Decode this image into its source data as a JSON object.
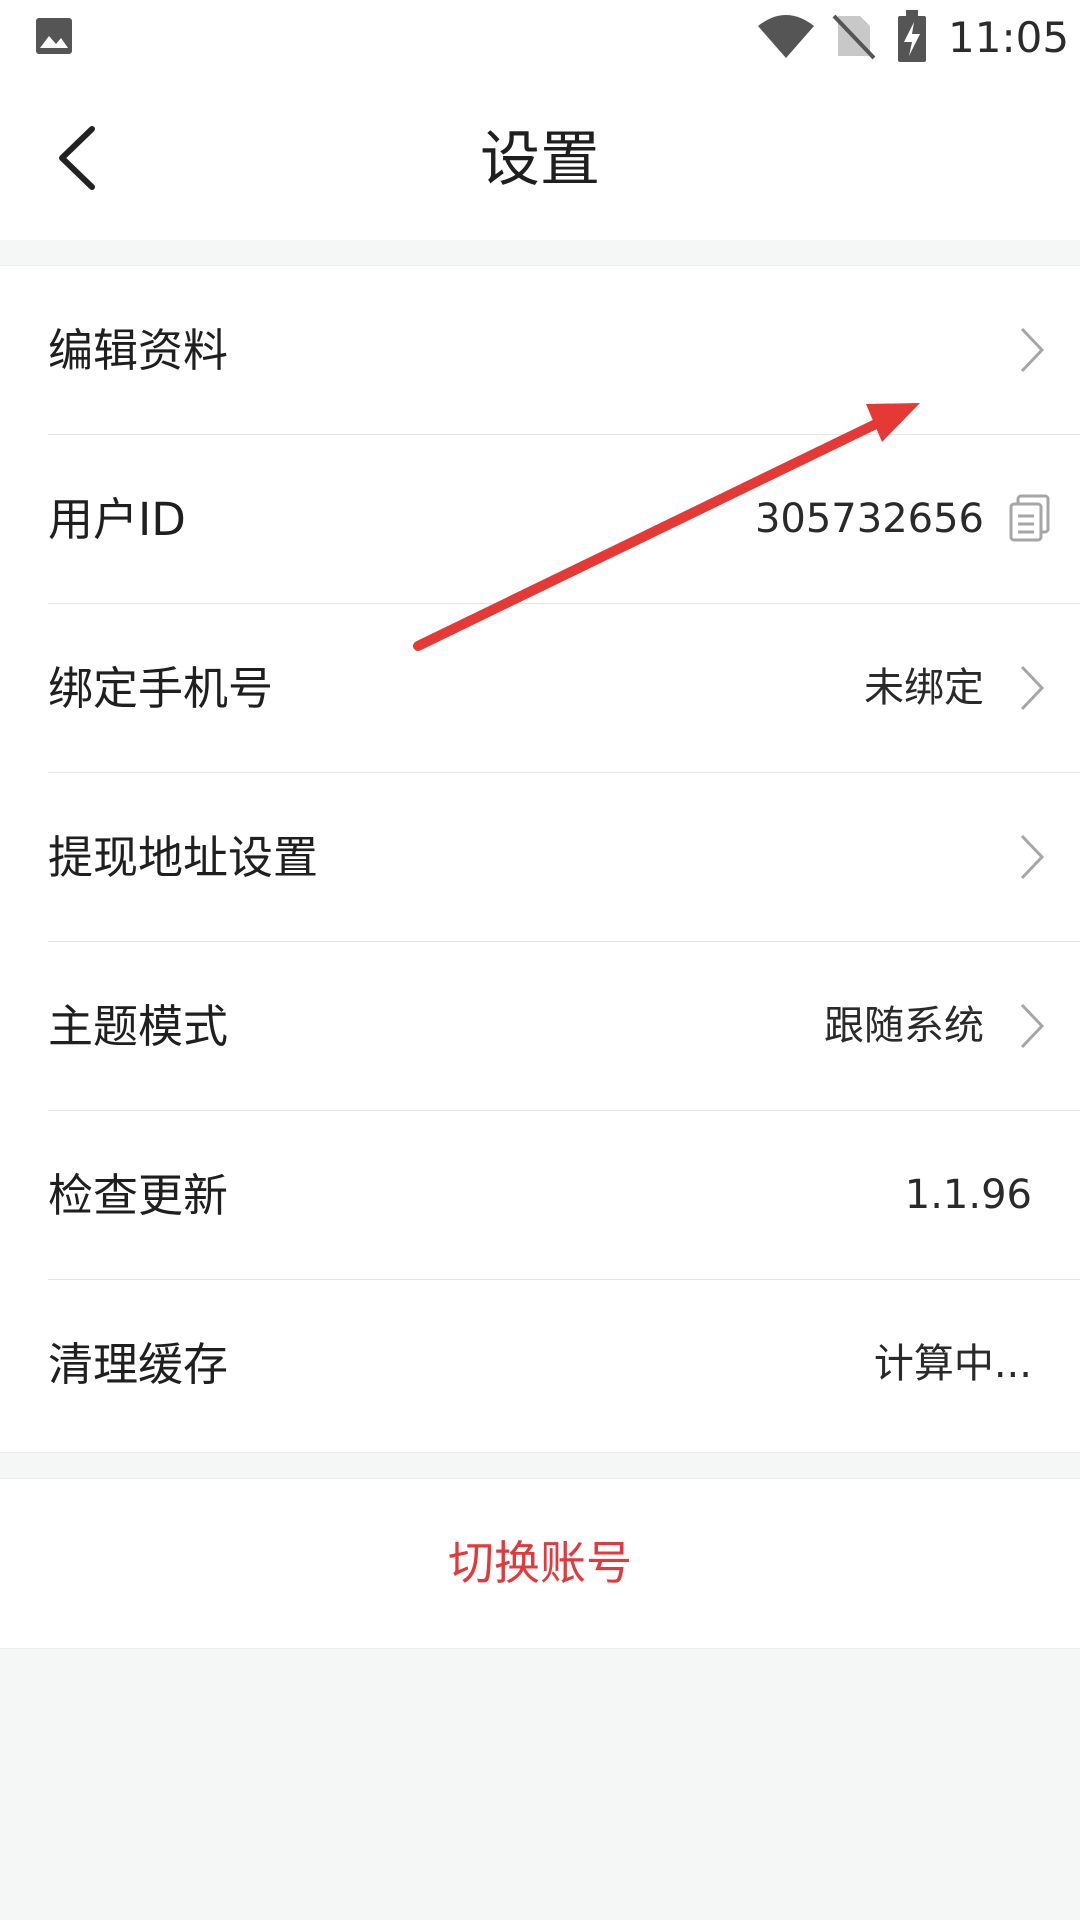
{
  "status_bar": {
    "time": "11:05",
    "icons": [
      "gallery-icon",
      "wifi-icon",
      "no-sim-icon",
      "battery-charging-icon"
    ]
  },
  "header": {
    "title": "设置",
    "back_icon": "chevron-left-icon"
  },
  "settings": {
    "edit_profile": {
      "label": "编辑资料"
    },
    "user_id": {
      "label": "用户ID",
      "value": "305732656"
    },
    "bind_phone": {
      "label": "绑定手机号",
      "value": "未绑定"
    },
    "withdraw_address": {
      "label": "提现地址设置"
    },
    "theme_mode": {
      "label": "主题模式",
      "value": "跟随系统"
    },
    "check_update": {
      "label": "检查更新",
      "value": "1.1.96"
    },
    "clear_cache": {
      "label": "清理缓存",
      "value": "计算中..."
    }
  },
  "switch_account": {
    "label": "切换账号"
  },
  "colors": {
    "accent": "#e4393c",
    "background": "#f5f6f6",
    "surface": "#ffffff",
    "annotation_arrow": "#e53935"
  }
}
